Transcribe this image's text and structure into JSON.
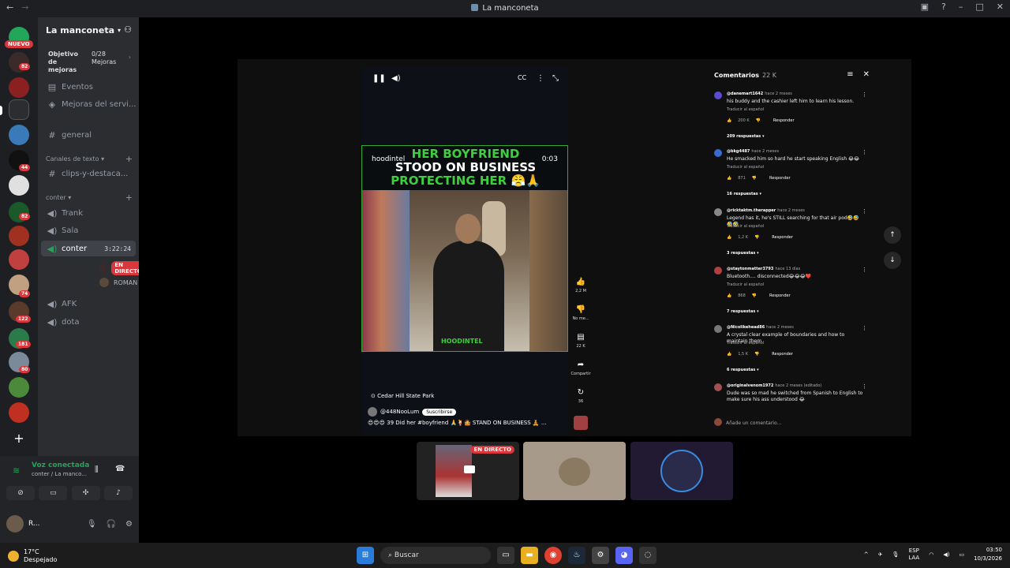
{
  "window": {
    "title": "La manconeta"
  },
  "rail": {
    "nuevo": "NUEVO",
    "badges": [
      "82",
      "44",
      "82",
      "74",
      "122",
      "181",
      "80"
    ]
  },
  "server": {
    "name": "La manconeta",
    "goal_label": "Objetivo de mejoras",
    "goal_count": "0/28",
    "goal_unit": "Mejoras",
    "events": "Eventos",
    "boosts": "Mejoras del servi...",
    "general": "general",
    "text_category": "Canales de texto",
    "clips": "clips-y-destaca...",
    "voice_category": "conter",
    "voice_channels": [
      "Trank",
      "Sala",
      "conter",
      "AFK",
      "dota"
    ],
    "live_timer": "3:22:24",
    "live_badge": "EN DIRECTO",
    "member2": "ROMAN"
  },
  "voice_panel": {
    "status": "Voz conectada",
    "location": "conter / La manco...",
    "user_name": "R..."
  },
  "video": {
    "caption_line1": "HER BOYFRIEND",
    "caption_line2": "STOOD ON BUSINESS",
    "caption_line3": "PROTECTING HER 😤🙏",
    "handle_watermark": "hoodintel",
    "time": "0:03",
    "watermark": "HOODINTEL",
    "location": "Cedar Hill State Park",
    "channel": "@448NooLum",
    "subscribe": "Suscribirse",
    "description": "😍😍😍 39 Did her #boyfriend 🙏🍹🤷 STAND ON BUSINESS 🧘 ...",
    "likes": "2,2 M",
    "dislike_label": "No me...",
    "comment_count": "22 K",
    "share_label": "Compartir",
    "remix_count": "36"
  },
  "comments": {
    "title": "Comentarios",
    "count": "22 K",
    "items": [
      {
        "user": "@danemart1642",
        "when": "hace 2 meses",
        "text": "his buddy and the cashier left him to learn his lesson.",
        "translate": "Traducir al español",
        "likes": "200 K",
        "reply": "Responder",
        "replies": "209 respuestas",
        "color": "#5b4bd0"
      },
      {
        "user": "@bkg4487",
        "when": "hace 2 meses",
        "text": "He smacked him so hard he start speaking English 😂😂",
        "translate": "Traducir al español",
        "likes": "871",
        "reply": "Responder",
        "replies": "16 respuestas",
        "color": "#3a6ad0"
      },
      {
        "user": "@ricktaktm.therapper",
        "when": "hace 2 meses",
        "text": "Legend has it, he's STILL searching for that air pod🤣🤣🤣🤣",
        "translate": "Traducir al español",
        "likes": "1,2 K",
        "reply": "Responder",
        "replies": "3 respuestas",
        "color": "#888888"
      },
      {
        "user": "@staytonmatter3793",
        "when": "hace 13 días",
        "text": "Bluetooth.... disconnected😂😂😂❤️",
        "translate": "Traducir al español",
        "likes": "868",
        "reply": "Responder",
        "replies": "7 respuestas",
        "color": "#b04040"
      },
      {
        "user": "@Nicolikehead86",
        "when": "hace 2 meses",
        "text": "A crystal clear example of boundaries and how to maintain them",
        "translate": "Traducir al español",
        "likes": "1,5 K",
        "reply": "Responder",
        "replies": "6 respuestas",
        "color": "#777777"
      },
      {
        "user": "@originalvenom1972",
        "when": "hace 2 meses (editado)",
        "text": "Dude was so mad he switched from Spanish to English to make sure his ass understood 😂",
        "color": "#a05050"
      }
    ],
    "add_placeholder": "Añade un comentario..."
  },
  "tiles": {
    "live_badge": "EN DIRECTO"
  },
  "taskbar": {
    "temp": "17°C",
    "weather": "Despejado",
    "search": "Buscar",
    "lang1": "ESP",
    "lang2": "LAA",
    "time": "03:50",
    "date": "10/3/2026"
  }
}
